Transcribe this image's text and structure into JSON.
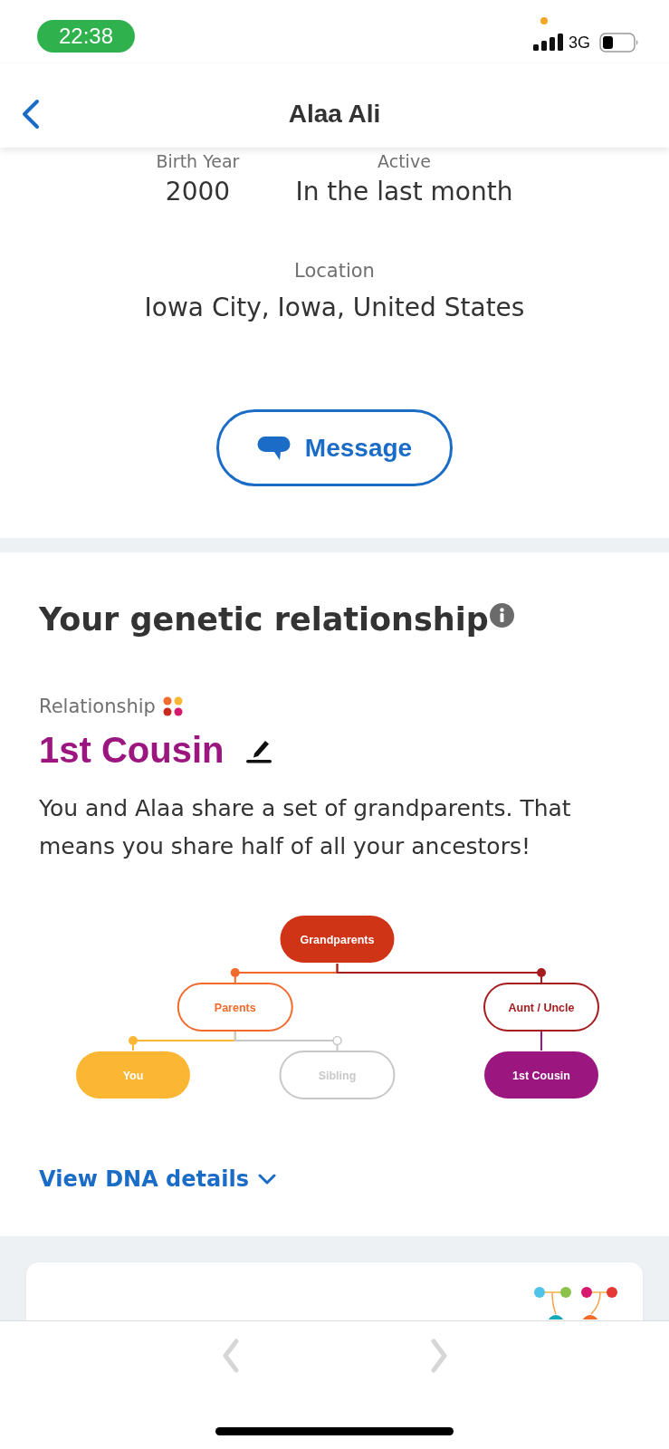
{
  "status_bar": {
    "time": "22:38",
    "network": "3G"
  },
  "header": {
    "title": "Alaa Ali"
  },
  "profile": {
    "facts": [
      {
        "label": "Birth Year",
        "value": "2000"
      },
      {
        "label": "Active",
        "value": "In the last month"
      }
    ],
    "location": {
      "label": "Location",
      "value": "Iowa City, Iowa, United States"
    },
    "message_button": "Message"
  },
  "genetic_relationship": {
    "title": "Your genetic relationship",
    "relationship_label": "Relationship",
    "relationship": "1st Cousin",
    "description": "You and Alaa share a set of grandparents. That means you share half of all your ancestors!",
    "tree": {
      "label": "Grandparents",
      "kind": "filled",
      "color": "#cf3416",
      "children": [
        {
          "label": "Parents",
          "kind": "outline",
          "color": "#f26a2c",
          "children": [
            {
              "label": "You",
              "kind": "filled",
              "color": "#fbb634"
            },
            {
              "label": "Sibling",
              "kind": "muted",
              "color": "#c8c8c8"
            }
          ]
        },
        {
          "label": "Aunt / Uncle",
          "kind": "outline",
          "color": "#a51c1f",
          "children": [
            {
              "label": "1st Cousin",
              "kind": "filled",
              "color": "#9c1680"
            }
          ]
        }
      ]
    },
    "details_link": "View DNA details"
  },
  "browser_nav": {
    "back": {
      "disabled": true
    },
    "forward": {
      "disabled": true
    }
  }
}
